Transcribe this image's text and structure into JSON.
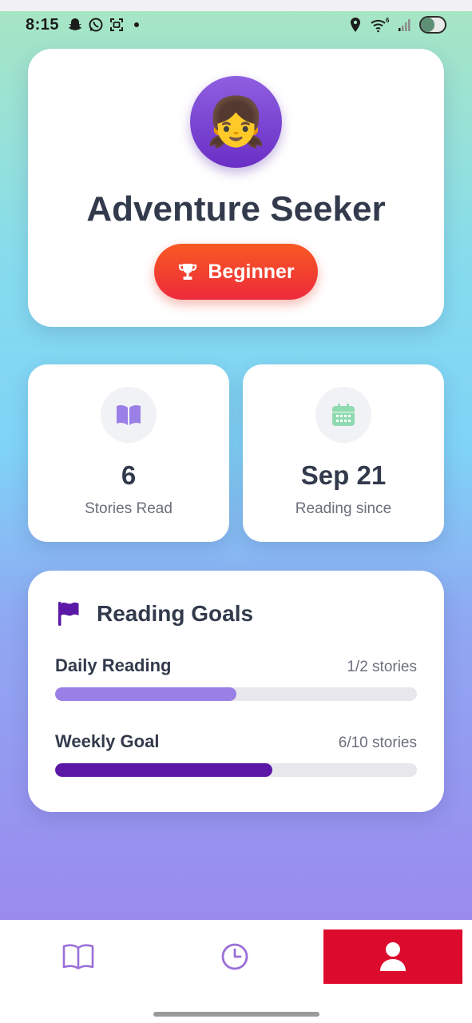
{
  "status_bar": {
    "time": "8:15",
    "left_icons": [
      "snapchat-icon",
      "whatsapp-icon",
      "screenshot-icon",
      "dot-icon"
    ],
    "right_icons": [
      "location-icon",
      "wifi-icon",
      "signal-icon",
      "battery-icon"
    ],
    "wifi_badge": "6"
  },
  "profile": {
    "avatar_emoji": "👧",
    "name": "Adventure Seeker",
    "level": "Beginner",
    "level_icon": "trophy-icon"
  },
  "stats": [
    {
      "icon": "book-icon",
      "value": "6",
      "label": "Stories Read",
      "icon_color": "#9a80e6"
    },
    {
      "icon": "calendar-icon",
      "value": "Sep 21",
      "label": "Reading since",
      "icon_color": "#8fdab0"
    }
  ],
  "goals": {
    "title": "Reading Goals",
    "icon": "flag-icon",
    "items": [
      {
        "name": "Daily Reading",
        "count": "1/2 stories",
        "progress": 0.5,
        "color": "#9a80e6"
      },
      {
        "name": "Weekly Goal",
        "count": "6/10 stories",
        "progress": 0.6,
        "color": "#5b18a6"
      }
    ]
  },
  "nav": {
    "items": [
      {
        "name": "stories",
        "icon": "book-open-icon",
        "active": false
      },
      {
        "name": "history",
        "icon": "clock-icon",
        "active": false
      },
      {
        "name": "profile",
        "icon": "user-icon",
        "active": true
      }
    ],
    "active_color": "#dc0a2c",
    "inactive_icon_color": "#9a6fd8"
  }
}
